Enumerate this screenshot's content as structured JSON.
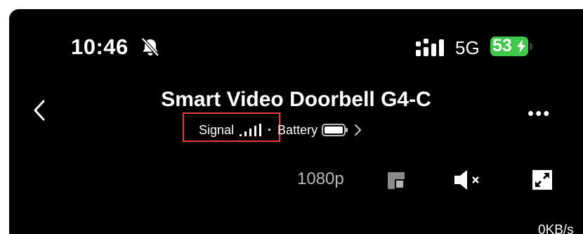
{
  "status_bar": {
    "time": "10:46",
    "network": "5G",
    "battery_percent": "53",
    "battery_color": "#3ec94b"
  },
  "header": {
    "title": "Smart Video Doorbell G4-C",
    "signal_label": "Signal",
    "separator": "·",
    "battery_label": "Battery"
  },
  "video_controls": {
    "resolution": "1080p",
    "icons": [
      "picture-in-picture-icon",
      "mute-icon",
      "fullscreen-icon"
    ]
  },
  "stream": {
    "speed": "0KB/s"
  },
  "highlight_color": "#e33b3f"
}
